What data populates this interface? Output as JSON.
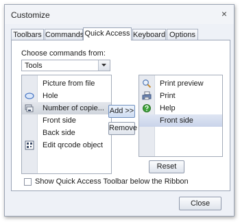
{
  "window": {
    "title": "Customize",
    "close_glyph": "×"
  },
  "tabs": [
    {
      "label": "Toolbars"
    },
    {
      "label": "Commands"
    },
    {
      "label": "Quick Access"
    },
    {
      "label": "Keyboard"
    },
    {
      "label": "Options"
    }
  ],
  "active_tab": "Quick Access",
  "choose": {
    "label": "Choose commands from:",
    "value": "Tools"
  },
  "left_list": [
    {
      "label": "Picture from file",
      "icon": "none"
    },
    {
      "label": "Hole",
      "icon": "hole-icon"
    },
    {
      "label": "Number of copie...",
      "icon": "copies-icon",
      "highlighted": true
    },
    {
      "label": "Front side",
      "icon": "none"
    },
    {
      "label": "Back side",
      "icon": "none"
    },
    {
      "label": "Edit qrcode object",
      "icon": "qrcode-icon"
    }
  ],
  "right_list": [
    {
      "label": "Print preview",
      "icon": "print-preview-icon"
    },
    {
      "label": "Print",
      "icon": "print-icon"
    },
    {
      "label": "Help",
      "icon": "help-icon"
    },
    {
      "label": "Front side",
      "icon": "none",
      "selected": true
    }
  ],
  "buttons": {
    "add": "Add >>",
    "remove": "Remove",
    "reset": "Reset",
    "close": "Close"
  },
  "checkbox": {
    "label": "Show Quick Access Toolbar below the Ribbon",
    "checked": false
  },
  "colors": {
    "accent": "#5b83c2",
    "help_green": "#3ea33a",
    "selection": "#c9d4ea"
  }
}
